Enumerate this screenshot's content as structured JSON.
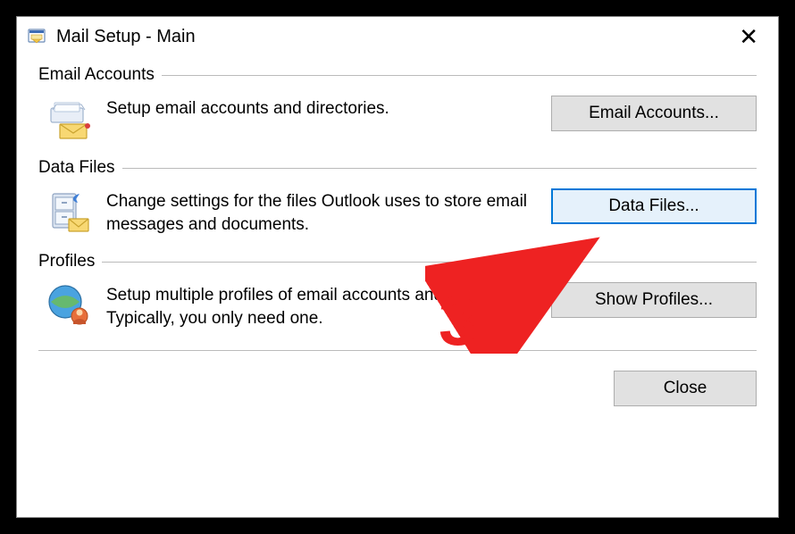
{
  "titlebar": {
    "title": "Mail Setup - Main"
  },
  "groups": {
    "email": {
      "label": "Email Accounts",
      "desc": "Setup email accounts and directories.",
      "button": "Email Accounts..."
    },
    "datafiles": {
      "label": "Data Files",
      "desc": "Change settings for the files Outlook uses to store email messages and documents.",
      "button": "Data Files..."
    },
    "profiles": {
      "label": "Profiles",
      "desc": "Setup multiple profiles of email accounts and data files. Typically, you only need one.",
      "button": "Show Profiles..."
    }
  },
  "footer": {
    "close": "Close"
  },
  "annotation": {
    "number": "3"
  }
}
